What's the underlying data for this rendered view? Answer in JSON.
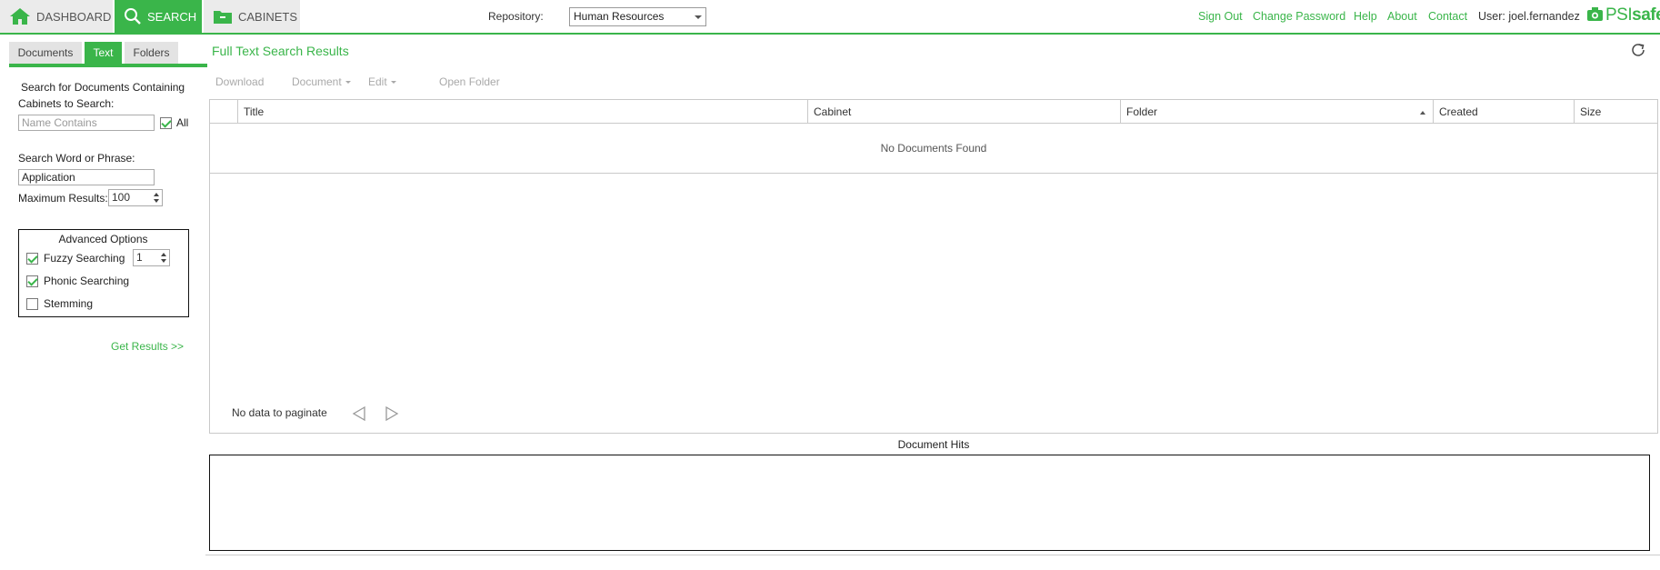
{
  "nav": {
    "tabs": [
      {
        "label": "DASHBOARD",
        "icon": "home-icon"
      },
      {
        "label": "SEARCH",
        "icon": "search-icon"
      },
      {
        "label": "CABINETS",
        "icon": "cabinet-icon"
      }
    ],
    "active_tab": "SEARCH"
  },
  "repository": {
    "label": "Repository:",
    "selected": "Human Resources"
  },
  "top_links": {
    "sign_out": "Sign Out",
    "change_password": "Change Password",
    "help": "Help",
    "about": "About",
    "contact": "Contact",
    "user": "User: joel.fernandez"
  },
  "brand": {
    "prefix": "PSI",
    "suffix": "safe",
    "icon": "camera-icon",
    "color": "#3ab54a"
  },
  "left_panel": {
    "tabs": [
      "Documents",
      "Text",
      "Folders"
    ],
    "active_tab": "Text",
    "heading": "Search for Documents Containing",
    "cabinets_label": "Cabinets to Search:",
    "name_placeholder": "Name Contains",
    "all_label": "All",
    "all_checked": true,
    "phrase_label": "Search Word or Phrase:",
    "phrase_value": "Application",
    "max_results_label": "Maximum Results:",
    "max_results_value": "100",
    "advanced": {
      "title": "Advanced Options",
      "fuzzy_label": "Fuzzy Searching",
      "fuzzy_checked": true,
      "fuzzy_value": "1",
      "phonic_label": "Phonic Searching",
      "phonic_checked": true,
      "stemming_label": "Stemming",
      "stemming_checked": false
    },
    "get_results": "Get Results >>"
  },
  "main": {
    "title": "Full Text Search Results",
    "toolbar": {
      "download": "Download",
      "document": "Document",
      "edit": "Edit",
      "open_folder": "Open Folder"
    },
    "columns": [
      "Title",
      "Cabinet",
      "Folder",
      "Created",
      "Size"
    ],
    "sorted_column": "Folder",
    "empty_message": "No Documents Found",
    "pager_text": "No data to paginate",
    "hits_label": "Document Hits"
  },
  "colors": {
    "accent": "#3ab54a",
    "tab_inactive": "#ebebeb"
  }
}
